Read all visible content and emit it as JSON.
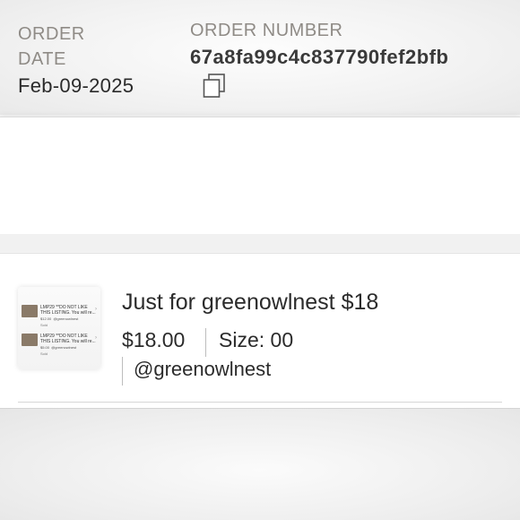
{
  "order": {
    "date_label": "ORDER DATE",
    "date_value": "Feb-09-2025",
    "number_label": "ORDER NUMBER",
    "number_value": "67a8fa99c4c837790fef2bfb"
  },
  "item": {
    "title": "Just for greenowlnest $18",
    "price": "$18.00",
    "size": "Size: 00",
    "seller": "@greenowlnest",
    "thumbnail": {
      "rows": [
        {
          "text": "LMP29 **DO NOT LIKE THIS LISTING. You will re...",
          "price": "$12.00",
          "user": "@greenowlnest",
          "status": "Sold"
        },
        {
          "text": "LMP29 **DO NOT LIKE THIS LISTING. You will re...",
          "price": "$5.00",
          "user": "@greenowlnest",
          "status": "Sold"
        }
      ]
    }
  },
  "icons": {
    "copy": "copy-icon",
    "chevron": "chevron-right-icon"
  },
  "colors": {
    "label": "#8f8b86",
    "text": "#2a2a2a",
    "panel": "#ffffff",
    "background": "#f4f4f4"
  }
}
